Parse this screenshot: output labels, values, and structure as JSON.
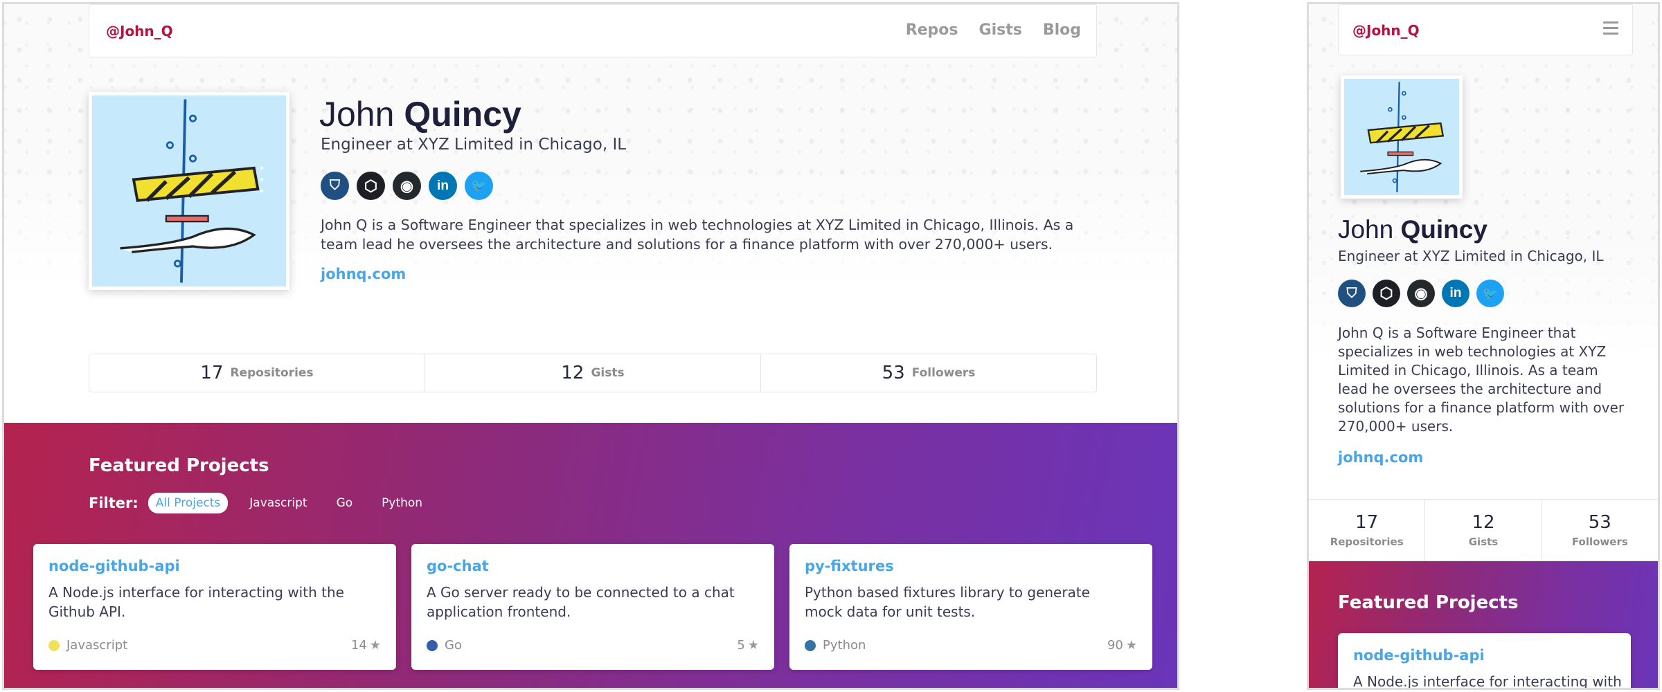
{
  "brand": "@John_Q",
  "nav": [
    "Repos",
    "Gists",
    "Blog"
  ],
  "profile": {
    "first_name": "John",
    "last_name": "Quincy",
    "title": "Engineer at XYZ Limited in Chicago, IL",
    "bio": "John Q is a Software Engineer that specializes in web technologies at XYZ Limited in Chicago, Illinois. As a team lead he oversees the architecture and solutions for a finance platform with over 270,000+ users.",
    "website": "johnq.com"
  },
  "social": [
    {
      "name": "bitbucket-icon",
      "glyph": "⛉",
      "color": "#205081"
    },
    {
      "name": "codepen-icon",
      "glyph": "⬡",
      "color": "#1e1f26"
    },
    {
      "name": "github-icon",
      "glyph": "◉",
      "color": "#24292e"
    },
    {
      "name": "linkedin-icon",
      "glyph": "in",
      "color": "#0077b5"
    },
    {
      "name": "twitter-icon",
      "glyph": "🐦",
      "color": "#1da1f2"
    }
  ],
  "stats": [
    {
      "value": "17",
      "label": "Repositories"
    },
    {
      "value": "12",
      "label": "Gists"
    },
    {
      "value": "53",
      "label": "Followers"
    }
  ],
  "featured": {
    "title": "Featured Projects",
    "filter_label": "Filter:",
    "filters": [
      "All Projects",
      "Javascript",
      "Go",
      "Python"
    ],
    "active_filter": "All Projects"
  },
  "projects": [
    {
      "name": "node-github-api",
      "desc": "A Node.js interface for interacting with the Github API.",
      "lang": "Javascript",
      "lang_color": "#f1e05a",
      "stars": "14"
    },
    {
      "name": "go-chat",
      "desc": "A Go server ready to be connected to a chat application frontend.",
      "lang": "Go",
      "lang_color": "#375eab",
      "stars": "5"
    },
    {
      "name": "py-fixtures",
      "desc": "Python based fixtures library to generate mock data for unit tests.",
      "lang": "Python",
      "lang_color": "#3572a5",
      "stars": "90"
    }
  ],
  "mobile_project_desc": "A Node.js interface for interacting with",
  "colors": {
    "brand": "#b5133e",
    "link": "#4aa5e6",
    "gradient_start": "#b4234f",
    "gradient_end": "#6a35ba"
  }
}
